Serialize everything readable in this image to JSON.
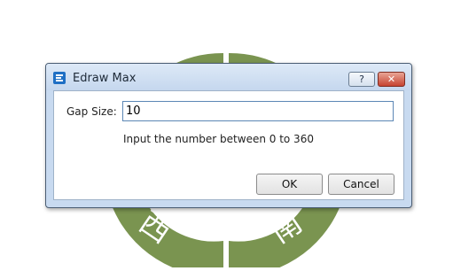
{
  "dialog": {
    "title": "Edraw Max",
    "help_glyph": "?",
    "close_glyph": "✕",
    "gap_label": "Gap Size:",
    "gap_value": "10",
    "hint": "Input the number between 0 to 360",
    "ok_label": "OK",
    "cancel_label": "Cancel"
  },
  "background": {
    "ring_color": "#7a9450",
    "labels": [
      "西",
      "南"
    ]
  }
}
